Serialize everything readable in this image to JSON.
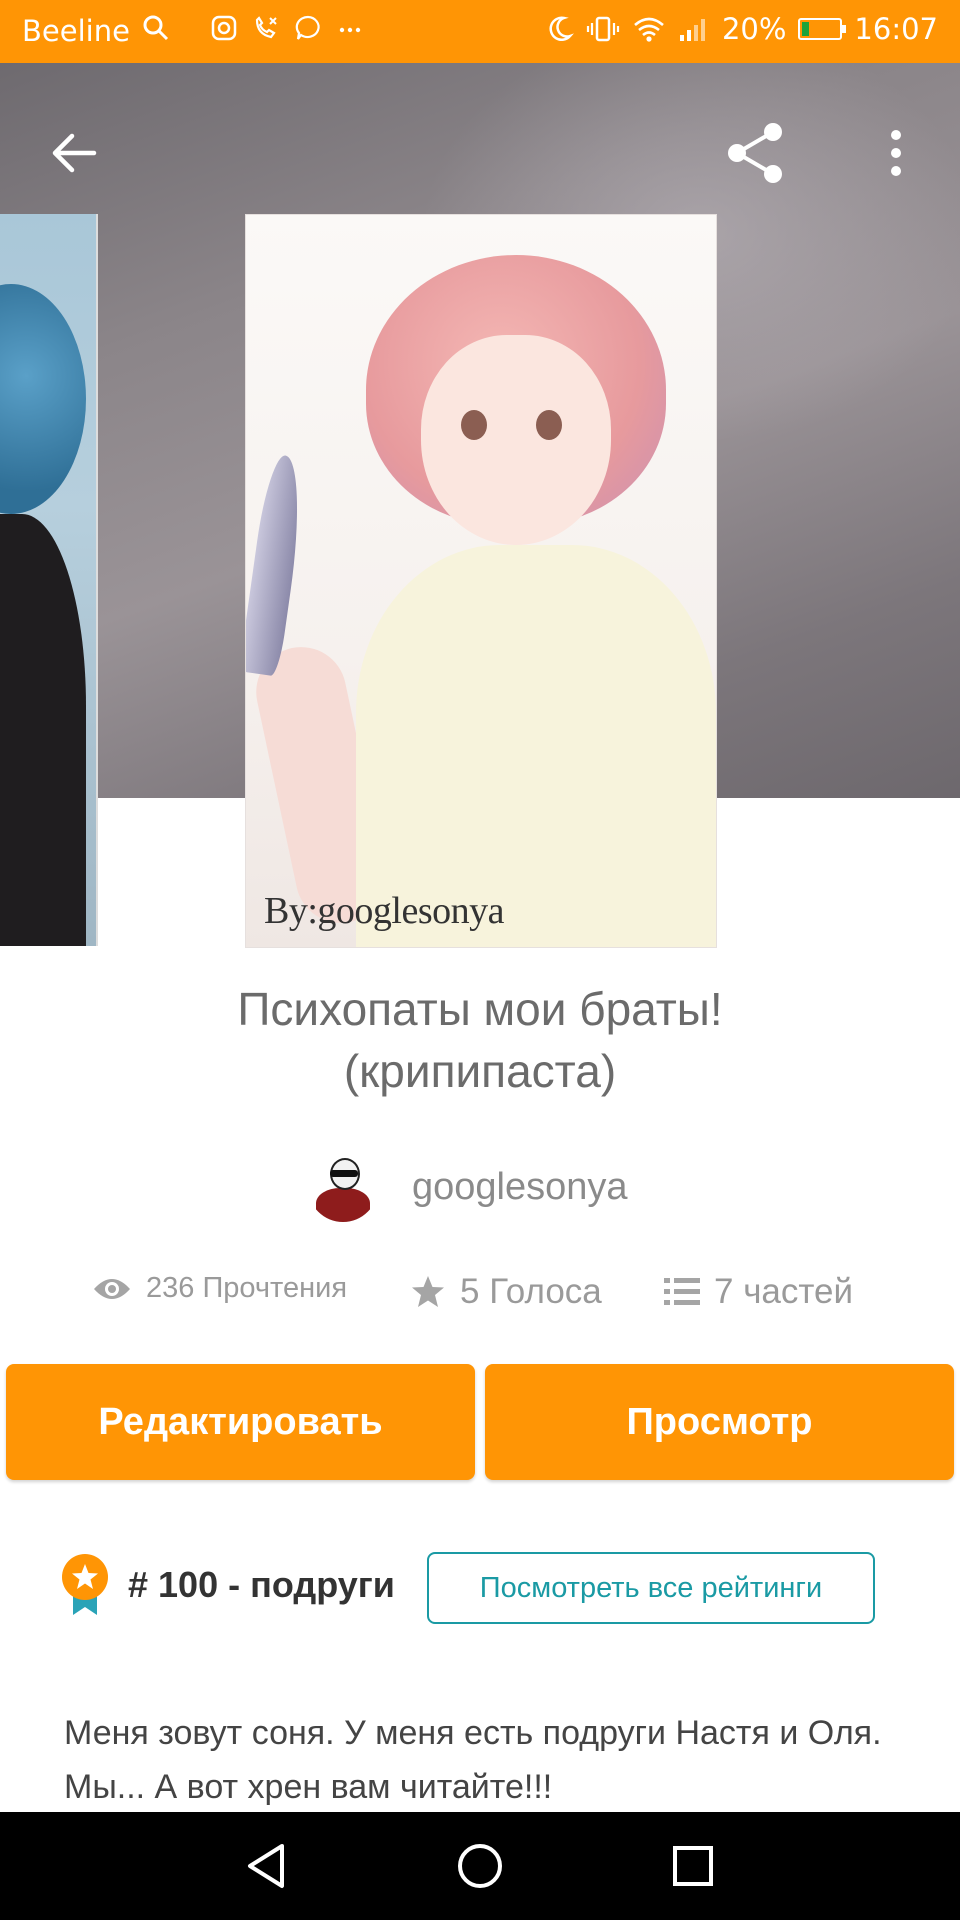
{
  "status_bar": {
    "carrier": "Beeline",
    "battery_percent": "20%",
    "battery_level": 0.2,
    "time": "16:07"
  },
  "story": {
    "cover_signature": "By:googlesonya",
    "title_line1": "Психопаты мои браты!",
    "title_line2": "(крипипаста)",
    "author": "googlesonya"
  },
  "stats": {
    "reads": "236 Прочтения",
    "votes": "5 Голоса",
    "parts": "7 частей"
  },
  "actions": {
    "edit_label": "Редактировать",
    "view_label": "Просмотр"
  },
  "ranking": {
    "text": "# 100 - подруги",
    "see_all_label": "Посмотреть все рейтинги"
  },
  "description": "Меня зовут соня. У меня есть подруги Настя и Оля. Мы... А вот хрен вам читайте!!!",
  "colors": {
    "accent": "#ff9505",
    "link": "#1a9aa4"
  }
}
